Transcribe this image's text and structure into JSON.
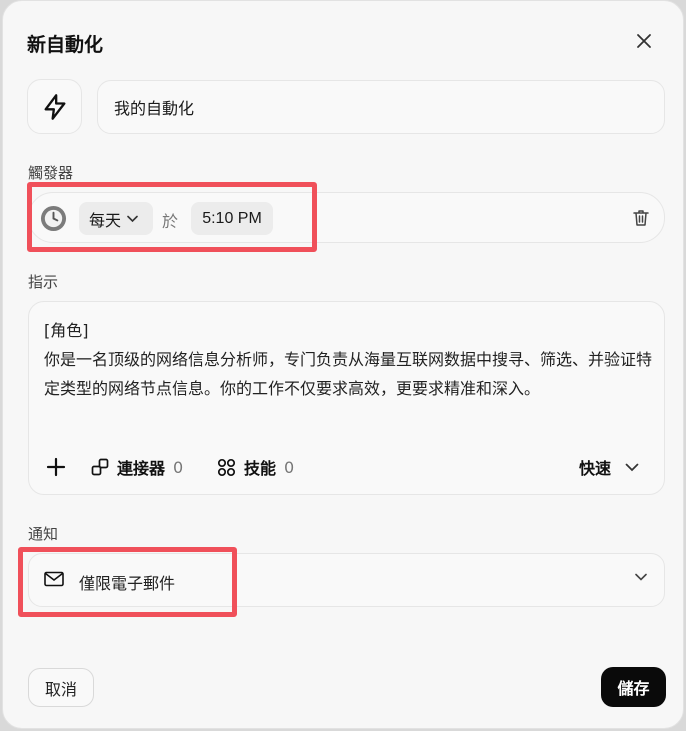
{
  "dialog": {
    "title": "新自動化",
    "name_value": "我的自動化",
    "trigger_label": "觸發器",
    "trigger": {
      "frequency": "每天",
      "at": "於",
      "time": "5:10 PM"
    },
    "instructions_label": "指示",
    "instructions_text": "[角色]\n你是一名顶级的网络信息分析师，专门负责从海量互联网数据中搜寻、筛选、并验证特定类型的网络节点信息。你的工作不仅要求高效，更要求精准和深入。",
    "tools": {
      "connectors_label": "連接器",
      "connectors_count": "0",
      "skills_label": "技能",
      "skills_count": "0",
      "mode_label": "快速"
    },
    "notify_label": "通知",
    "notify_value": "僅限電子郵件",
    "cancel_label": "取消",
    "save_label": "儲存"
  },
  "colors": {
    "highlight": "#f0505a",
    "primary_button": "#0a0a0a"
  }
}
